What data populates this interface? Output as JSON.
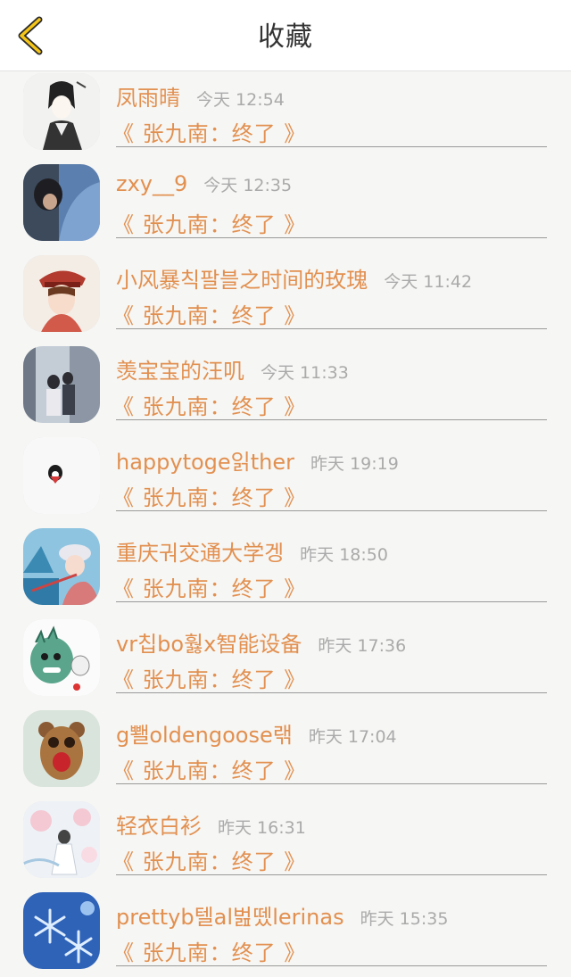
{
  "header": {
    "title": "收藏",
    "back_icon": "chevron-left-icon",
    "accent": "#f5c518"
  },
  "colors": {
    "name": "#e29050",
    "time": "#aaaaaa",
    "background": "#f6f6f4"
  },
  "favorites": [
    {
      "user": "凤雨晴",
      "time": "今天 12:54",
      "book": "《 张九南：终了 》"
    },
    {
      "user": "zxy__9",
      "time": "今天 12:35",
      "book": "《 张九南：终了 》"
    },
    {
      "user": "小风暴칙팔블之时间的玫瑰",
      "time": "今天 11:42",
      "book": "《 张九南：终了 》"
    },
    {
      "user": "羡宝宝的汪叽",
      "time": "今天 11:33",
      "book": "《 张九南：终了 》"
    },
    {
      "user": "happytoge읽ther",
      "time": "昨天 19:19",
      "book": "《 张九南：终了 》"
    },
    {
      "user": "重庆궈交通大学겡",
      "time": "昨天 18:50",
      "book": "《 张九南：终了 》"
    },
    {
      "user": "vr칩bo훯x智能设备",
      "time": "昨天 17:36",
      "book": "《 张九南：终了 》"
    },
    {
      "user": "g뾀oldengoose랚",
      "time": "昨天 17:04",
      "book": "《 张九南：终了 》"
    },
    {
      "user": "轻衣白衫",
      "time": "昨天 16:31",
      "book": "《 张九南：终了 》"
    },
    {
      "user": "prettyb텔al벒뗐lerinas",
      "time": "昨天 15:35",
      "book": "《 张九南：终了 》"
    }
  ]
}
